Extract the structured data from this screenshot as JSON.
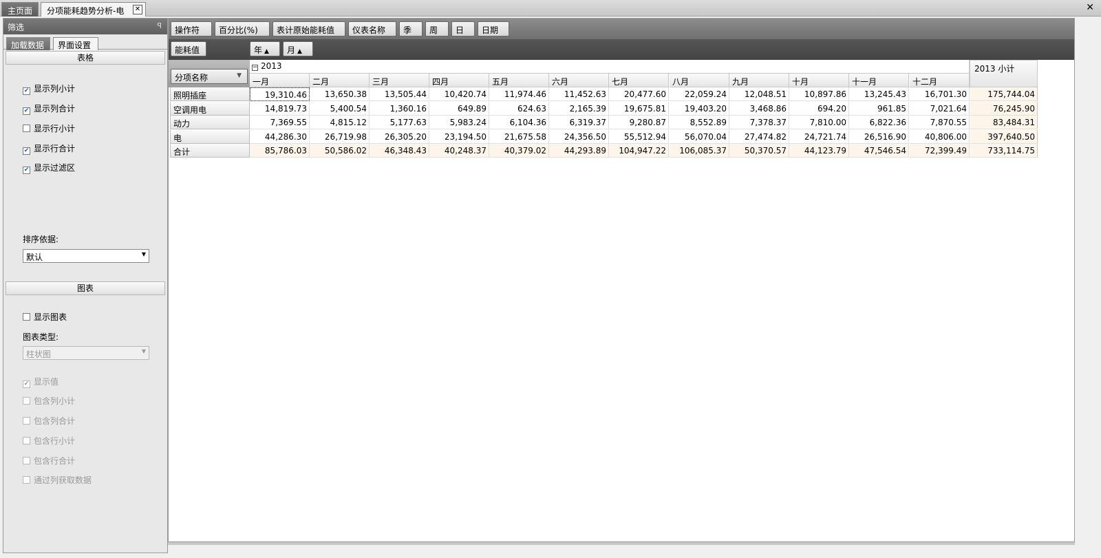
{
  "tabs": {
    "home": "主页面",
    "active": "分项能耗趋势分析-电",
    "close": "✕"
  },
  "window_close": "✕",
  "left_panel": {
    "title": "筛选",
    "pin": "ꟼ",
    "tab_load": "加载数据",
    "tab_ui": "界面设置",
    "table_section": "表格",
    "table_options": [
      {
        "label": "显示列小计",
        "checked": true
      },
      {
        "label": "显示列合计",
        "checked": true
      },
      {
        "label": "显示行小计",
        "checked": false
      },
      {
        "label": "显示行合计",
        "checked": true
      },
      {
        "label": "显示过滤区",
        "checked": true
      }
    ],
    "sort_label": "排序依据:",
    "sort_value": "默认",
    "chart_section": "图表",
    "show_chart": {
      "label": "显示图表",
      "checked": false
    },
    "chart_type_label": "图表类型:",
    "chart_type_value": "柱状图",
    "chart_options": [
      {
        "label": "显示值",
        "checked": true
      },
      {
        "label": "包含列小计",
        "checked": false
      },
      {
        "label": "包含列合计",
        "checked": false
      },
      {
        "label": "包含行小计",
        "checked": false
      },
      {
        "label": "包含行合计",
        "checked": false
      },
      {
        "label": "通过列获取数据",
        "checked": false
      }
    ]
  },
  "filter_fields": [
    "操作符",
    "百分比(%)",
    "表计原始能耗值",
    "仪表名称",
    "季",
    "周",
    "日",
    "日期"
  ],
  "data_field": "能耗值",
  "column_fields": [
    {
      "label": "年",
      "sort": "▲"
    },
    {
      "label": "月",
      "sort": "▲"
    }
  ],
  "row_field": {
    "label": "分项名称",
    "sort": "▼"
  },
  "pivot": {
    "year": "2013",
    "collapse": "−",
    "subtotal_header": "2013 小计",
    "months": [
      "一月",
      "二月",
      "三月",
      "四月",
      "五月",
      "六月",
      "七月",
      "八月",
      "九月",
      "十月",
      "十一月",
      "十二月"
    ],
    "rows": [
      {
        "label": "照明插座",
        "values": [
          "19,310.46",
          "13,650.38",
          "13,505.44",
          "10,420.74",
          "11,974.46",
          "11,452.63",
          "20,477.60",
          "22,059.24",
          "12,048.51",
          "10,897.86",
          "13,245.43",
          "16,701.30"
        ],
        "subtotal": "175,744.04"
      },
      {
        "label": "空调用电",
        "values": [
          "14,819.73",
          "5,400.54",
          "1,360.16",
          "649.89",
          "624.63",
          "2,165.39",
          "19,675.81",
          "19,403.20",
          "3,468.86",
          "694.20",
          "961.85",
          "7,021.64"
        ],
        "subtotal": "76,245.90"
      },
      {
        "label": "动力",
        "values": [
          "7,369.55",
          "4,815.12",
          "5,177.63",
          "5,983.24",
          "6,104.36",
          "6,319.37",
          "9,280.87",
          "8,552.89",
          "7,378.37",
          "7,810.00",
          "6,822.36",
          "7,870.55"
        ],
        "subtotal": "83,484.31"
      },
      {
        "label": "电",
        "values": [
          "44,286.30",
          "26,719.98",
          "26,305.20",
          "23,194.50",
          "21,675.58",
          "24,356.50",
          "55,512.94",
          "56,070.04",
          "27,474.82",
          "24,721.74",
          "26,516.90",
          "40,806.00"
        ],
        "subtotal": "397,640.50"
      }
    ],
    "total_row": {
      "label": "合计",
      "values": [
        "85,786.03",
        "50,586.02",
        "46,348.43",
        "40,248.37",
        "40,379.02",
        "44,293.89",
        "104,947.22",
        "106,085.37",
        "50,370.57",
        "44,123.79",
        "47,546.54",
        "72,399.49"
      ],
      "subtotal": "733,114.75"
    }
  }
}
